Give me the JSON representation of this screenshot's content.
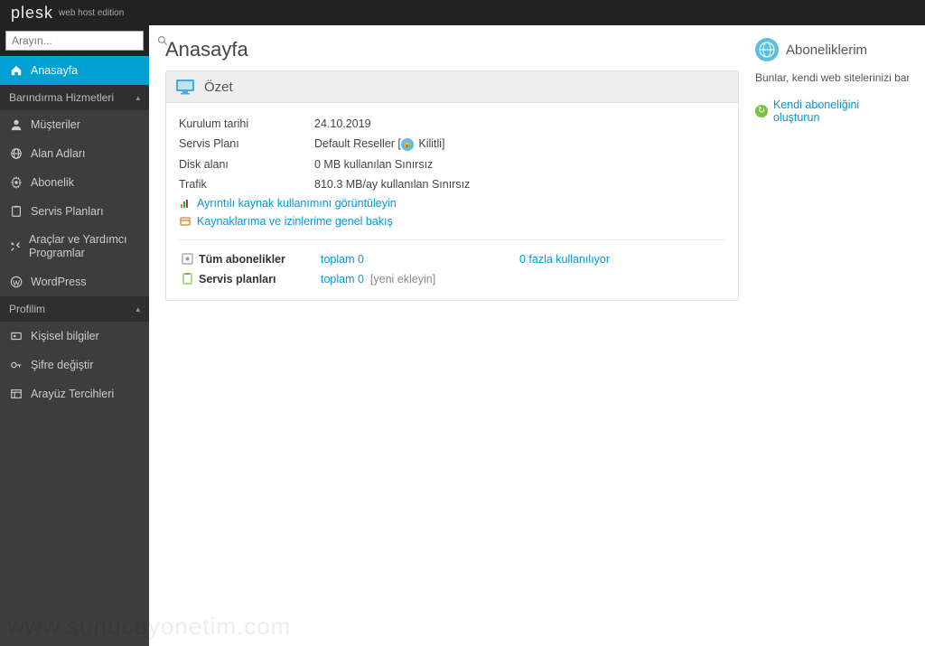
{
  "brand": {
    "name": "plesk",
    "edition": "web host edition"
  },
  "search": {
    "placeholder": "Arayın..."
  },
  "sidebar": {
    "home": "Anasayfa",
    "section_hosting": "Barındırma Hizmetleri",
    "customers": "Müşteriler",
    "domains": "Alan Adları",
    "subscription": "Abonelik",
    "service_plans": "Servis Planları",
    "tools": "Araçlar ve Yardımcı Programlar",
    "wordpress": "WordPress",
    "section_profile": "Profilim",
    "personal": "Kişisel bilgiler",
    "password": "Şifre değiştir",
    "interface": "Arayüz Tercihleri"
  },
  "page": {
    "title": "Anasayfa"
  },
  "summary": {
    "heading": "Özet",
    "rows": {
      "install_date_label": "Kurulum tarihi",
      "install_date_value": "24.10.2019",
      "service_plan_label": "Servis Planı",
      "service_plan_value_prefix": "Default Reseller [",
      "service_plan_locked": "Kilitli]",
      "disk_label": "Disk alanı",
      "disk_value": "0 MB kullanılan Sınırsız",
      "traffic_label": "Trafik",
      "traffic_value": "810.3 MB/ay kullanılan Sınırsız"
    },
    "links": {
      "detailed": "Ayrıntılı kaynak kullanımını görüntüleyin",
      "overview": "Kaynaklarıma ve izinlerime genel bakış"
    },
    "stats": {
      "all_subs_label": "Tüm abonelikler",
      "all_subs_total": "toplam 0",
      "all_subs_extra": "0 fazla kullanılıyor",
      "plans_label": "Servis planları",
      "plans_total": "toplam 0",
      "plans_add": "[yeni ekleyin]"
    }
  },
  "subs_panel": {
    "heading": "Aboneliklerim",
    "text": "Bunlar, kendi web sitelerinizi barı",
    "create_link": "Kendi aboneliğini oluşturun"
  },
  "watermark": "www.sunucuyonetim.com"
}
